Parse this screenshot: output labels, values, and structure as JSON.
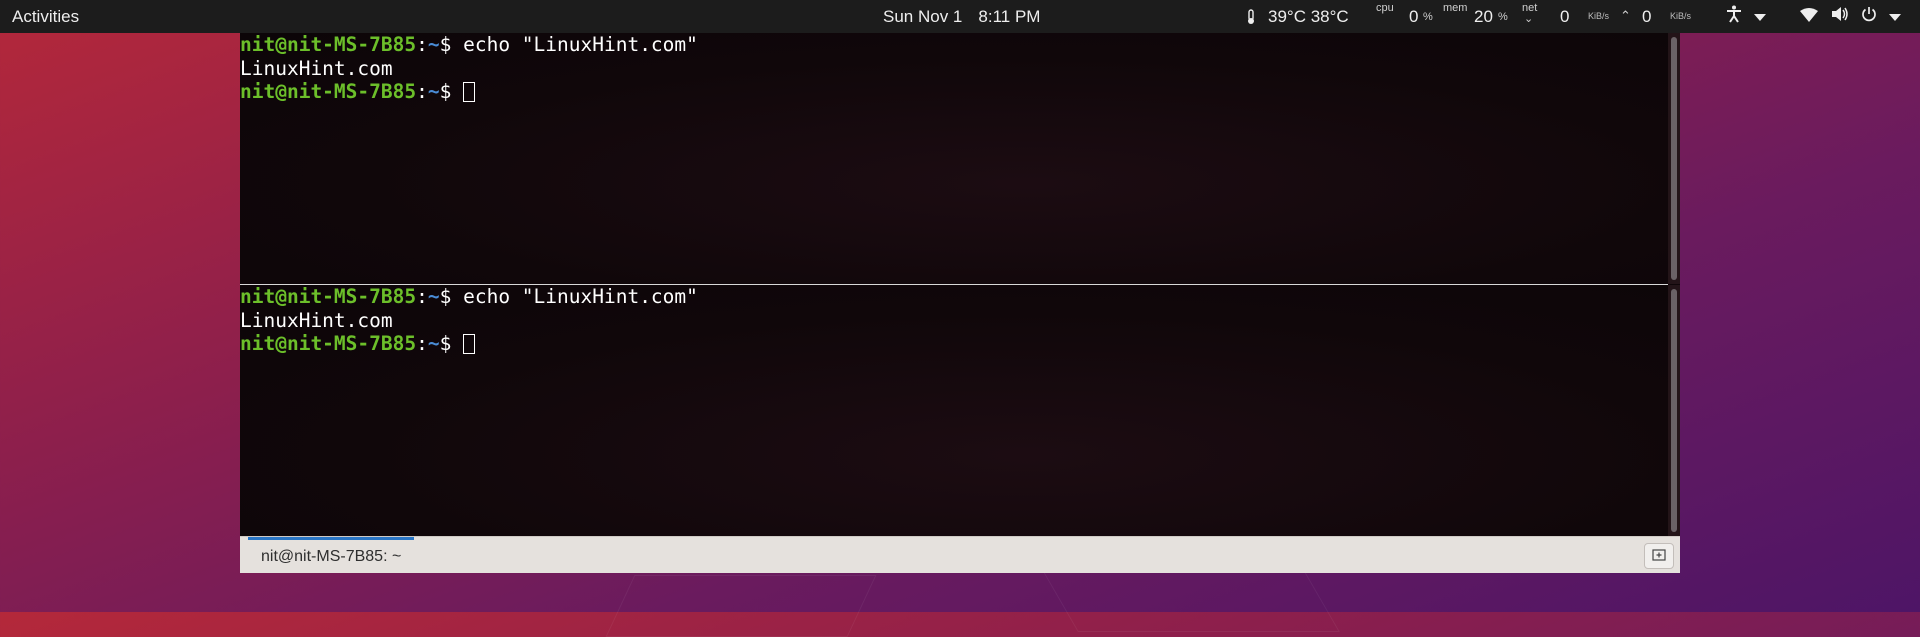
{
  "topbar": {
    "activities": "Activities",
    "date": "Sun Nov 1",
    "time": "8:11 PM",
    "temperatures": "39°C 38°C",
    "cpu_label": "cpu",
    "cpu_value": "0",
    "cpu_unit": "%",
    "mem_label": "mem",
    "mem_value": "20",
    "mem_unit": "%",
    "net_label": "net",
    "net_down_value": "0",
    "net_down_unit": "KiB/s",
    "net_up_value": "0",
    "net_up_unit": "KiB/s"
  },
  "terminal": {
    "top_pane": {
      "prompt_user": "nit@nit-MS-7B85",
      "prompt_path": "~",
      "command": "echo \"LinuxHint.com\"",
      "output": "LinuxHint.com"
    },
    "bottom_pane": {
      "prompt_user": "nit@nit-MS-7B85",
      "prompt_path": "~",
      "command": "echo \"LinuxHint.com\"",
      "output": "LinuxHint.com"
    },
    "prompt_colon": ":",
    "prompt_dollar": "$ ",
    "tab_title": "nit@nit-MS-7B85: ~"
  },
  "colors": {
    "prompt_user": "#6cbf2a",
    "prompt_path": "#4a8cd6",
    "tab_accent": "#2a76c6"
  }
}
